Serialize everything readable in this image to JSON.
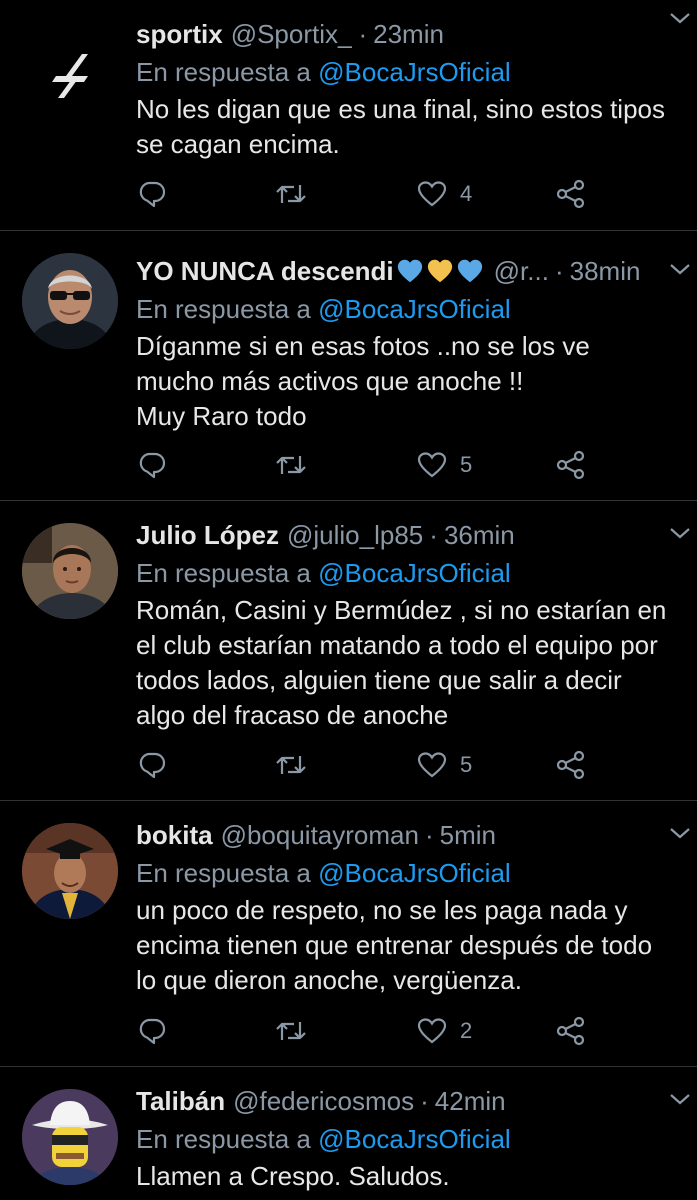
{
  "colors": {
    "background": "#000000",
    "divider": "#2f3336",
    "muted": "#8b98a5",
    "mention": "#1d9bf0",
    "text": "#e7e7e7"
  },
  "tweets": [
    {
      "username": "sportix",
      "handle": "@Sportix_",
      "time": "23min",
      "reply_prefix": "En respuesta a",
      "reply_to": "@BocaJrsOficial",
      "text": "No les digan que es una final, sino estos tipos\nse cagan encima.",
      "likes": "4",
      "avatar": "sportix-logo"
    },
    {
      "username": "YO NUNCA descendi",
      "username_emojis": [
        "blue-heart-icon",
        "yellow-heart-icon",
        "blue-heart-icon"
      ],
      "handle": "@r...",
      "time": "38min",
      "reply_prefix": "En respuesta a",
      "reply_to": "@BocaJrsOficial",
      "text": "Díganme si en esas fotos ..no se los ve\nmucho más activos que anoche !!\nMuy Raro todo",
      "likes": "5",
      "avatar": "man-with-sunglasses"
    },
    {
      "username": "Julio López",
      "handle": "@julio_lp85",
      "time": "36min",
      "reply_prefix": "En respuesta a",
      "reply_to": "@BocaJrsOficial",
      "text": "Román, Casini  y Bermúdez , si no estarían en\nel club estarían matando a todo el equipo por\ntodos lados,  alguien tiene que salir a decir\nalgo del fracaso de anoche",
      "likes": "5",
      "avatar": "man-portrait"
    },
    {
      "username": "bokita",
      "handle": "@boquitayroman",
      "time": "5min",
      "reply_prefix": "En respuesta a",
      "reply_to": "@BocaJrsOficial",
      "text": "un poco de respeto, no se les paga nada y\nencima tienen que entrenar después de todo\nlo que dieron anoche, vergüenza.",
      "likes": "2",
      "avatar": "graduate-portrait"
    },
    {
      "username": "Talibán",
      "handle": "@federicosmos",
      "time": "42min",
      "reply_prefix": "En respuesta a",
      "reply_to": "@BocaJrsOficial",
      "text": "Llamen a Crespo. Saludos.",
      "likes": "",
      "avatar": "cartoon-cowboy"
    }
  ]
}
